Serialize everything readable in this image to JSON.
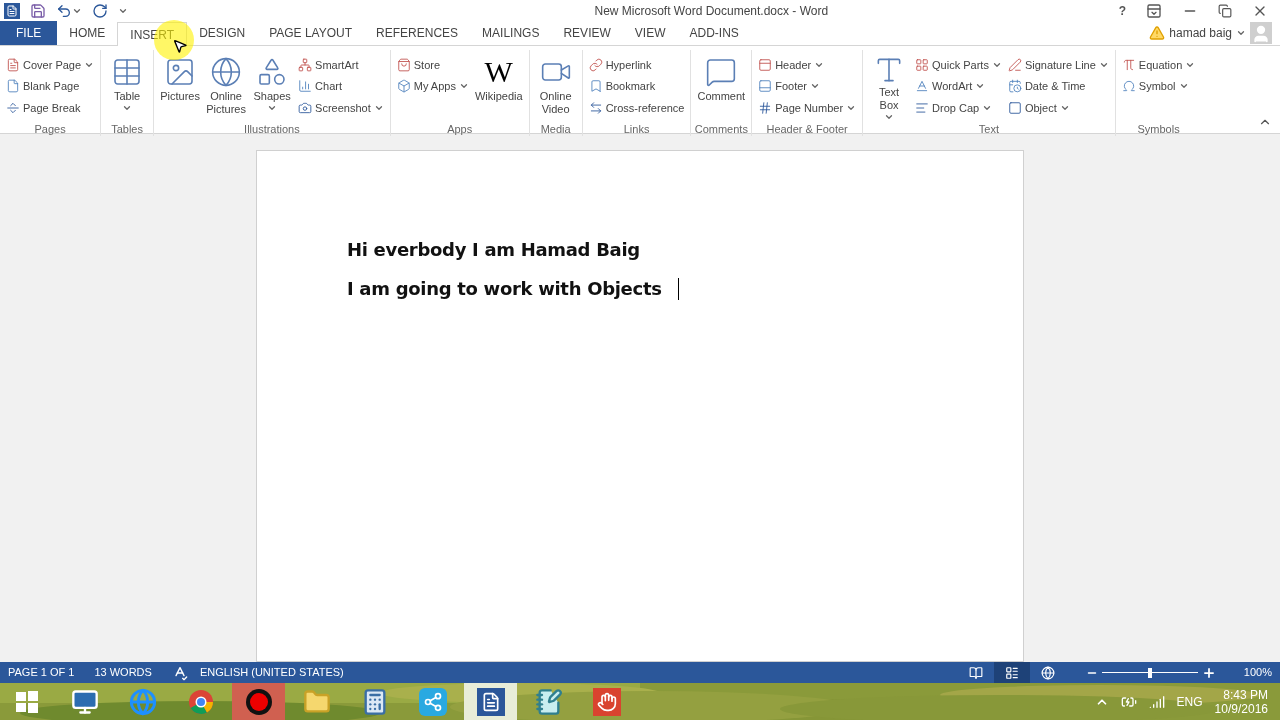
{
  "window": {
    "title": "New Microsoft Word Document.docx - Word",
    "help": "?"
  },
  "account": {
    "name": "hamad baig"
  },
  "tabs": [
    {
      "label": "FILE",
      "kind": "file",
      "selected": false
    },
    {
      "label": "HOME",
      "kind": "tab",
      "selected": false
    },
    {
      "label": "INSERT",
      "kind": "tab",
      "selected": true
    },
    {
      "label": "DESIGN",
      "kind": "tab",
      "selected": false
    },
    {
      "label": "PAGE LAYOUT",
      "kind": "tab",
      "selected": false
    },
    {
      "label": "REFERENCES",
      "kind": "tab",
      "selected": false
    },
    {
      "label": "MAILINGS",
      "kind": "tab",
      "selected": false
    },
    {
      "label": "REVIEW",
      "kind": "tab",
      "selected": false
    },
    {
      "label": "VIEW",
      "kind": "tab",
      "selected": false
    },
    {
      "label": "ADD-INS",
      "kind": "tab",
      "selected": false
    }
  ],
  "ribbon": [
    {
      "name": "Pages",
      "columns": [
        {
          "kind": "stack",
          "items": [
            {
              "label": "Cover Page",
              "dropdown": true
            },
            {
              "label": "Blank Page",
              "dropdown": false
            },
            {
              "label": "Page Break",
              "dropdown": false
            }
          ]
        }
      ]
    },
    {
      "name": "Tables",
      "columns": [
        {
          "kind": "large",
          "label": "Table",
          "dropdown": true
        }
      ]
    },
    {
      "name": "Illustrations",
      "columns": [
        {
          "kind": "large",
          "label": "Pictures",
          "dropdown": false
        },
        {
          "kind": "large",
          "label": "Online Pictures",
          "dropdown": false
        },
        {
          "kind": "large",
          "label": "Shapes",
          "dropdown": true
        },
        {
          "kind": "stack",
          "items": [
            {
              "label": "SmartArt",
              "dropdown": false
            },
            {
              "label": "Chart",
              "dropdown": false
            },
            {
              "label": "Screenshot",
              "dropdown": true
            }
          ]
        }
      ]
    },
    {
      "name": "Apps",
      "columns": [
        {
          "kind": "stack",
          "items": [
            {
              "label": "Store",
              "dropdown": false
            },
            {
              "label": "My Apps",
              "dropdown": true
            }
          ]
        },
        {
          "kind": "large",
          "label": "Wikipedia",
          "glyph": "W",
          "dropdown": false
        }
      ]
    },
    {
      "name": "Media",
      "columns": [
        {
          "kind": "large",
          "label": "Online Video",
          "dropdown": false
        }
      ]
    },
    {
      "name": "Links",
      "columns": [
        {
          "kind": "stack",
          "items": [
            {
              "label": "Hyperlink",
              "dropdown": false
            },
            {
              "label": "Bookmark",
              "dropdown": false
            },
            {
              "label": "Cross-reference",
              "dropdown": false
            }
          ]
        }
      ]
    },
    {
      "name": "Comments",
      "columns": [
        {
          "kind": "large",
          "label": "Comment",
          "dropdown": false
        }
      ]
    },
    {
      "name": "Header & Footer",
      "columns": [
        {
          "kind": "stack",
          "items": [
            {
              "label": "Header",
              "dropdown": true
            },
            {
              "label": "Footer",
              "dropdown": true
            },
            {
              "label": "Page Number",
              "dropdown": true
            }
          ]
        }
      ]
    },
    {
      "name": "Text",
      "columns": [
        {
          "kind": "large",
          "label": "Text Box",
          "dropdown": true
        },
        {
          "kind": "stack",
          "items": [
            {
              "label": "Quick Parts",
              "dropdown": true
            },
            {
              "label": "WordArt",
              "dropdown": true
            },
            {
              "label": "Drop Cap",
              "dropdown": true
            }
          ]
        },
        {
          "kind": "stack",
          "items": [
            {
              "label": "Signature Line",
              "dropdown": true
            },
            {
              "label": "Date & Time",
              "dropdown": false
            },
            {
              "label": "Object",
              "dropdown": true
            }
          ]
        }
      ]
    },
    {
      "name": "Symbols",
      "columns": [
        {
          "kind": "stack",
          "items": [
            {
              "label": "Equation",
              "dropdown": true
            },
            {
              "label": "Symbol",
              "dropdown": true
            }
          ]
        }
      ]
    }
  ],
  "document": {
    "paragraphs": [
      "Hi everbody I am Hamad Baig",
      "I am going to work with Objects"
    ]
  },
  "status_bar": {
    "page": "PAGE 1 OF 1",
    "words": "13 WORDS",
    "language": "ENGLISH (UNITED STATES)",
    "views": [
      {
        "selected": false
      },
      {
        "selected": true
      },
      {
        "selected": false
      }
    ],
    "zoom": {
      "level": 0.5,
      "reading": "100%"
    }
  },
  "taskbar": {
    "apps": [
      {
        "selected": false
      },
      {
        "selected": false
      },
      {
        "selected": false
      },
      {
        "selected": false
      },
      {
        "selected": true
      },
      {
        "selected": false
      },
      {
        "selected": false
      },
      {
        "selected": false
      },
      {
        "selected": true
      },
      {
        "selected": false
      },
      {
        "selected": false
      }
    ],
    "language": "ENG",
    "time": "8:43 PM",
    "date": "10/9/2016"
  }
}
